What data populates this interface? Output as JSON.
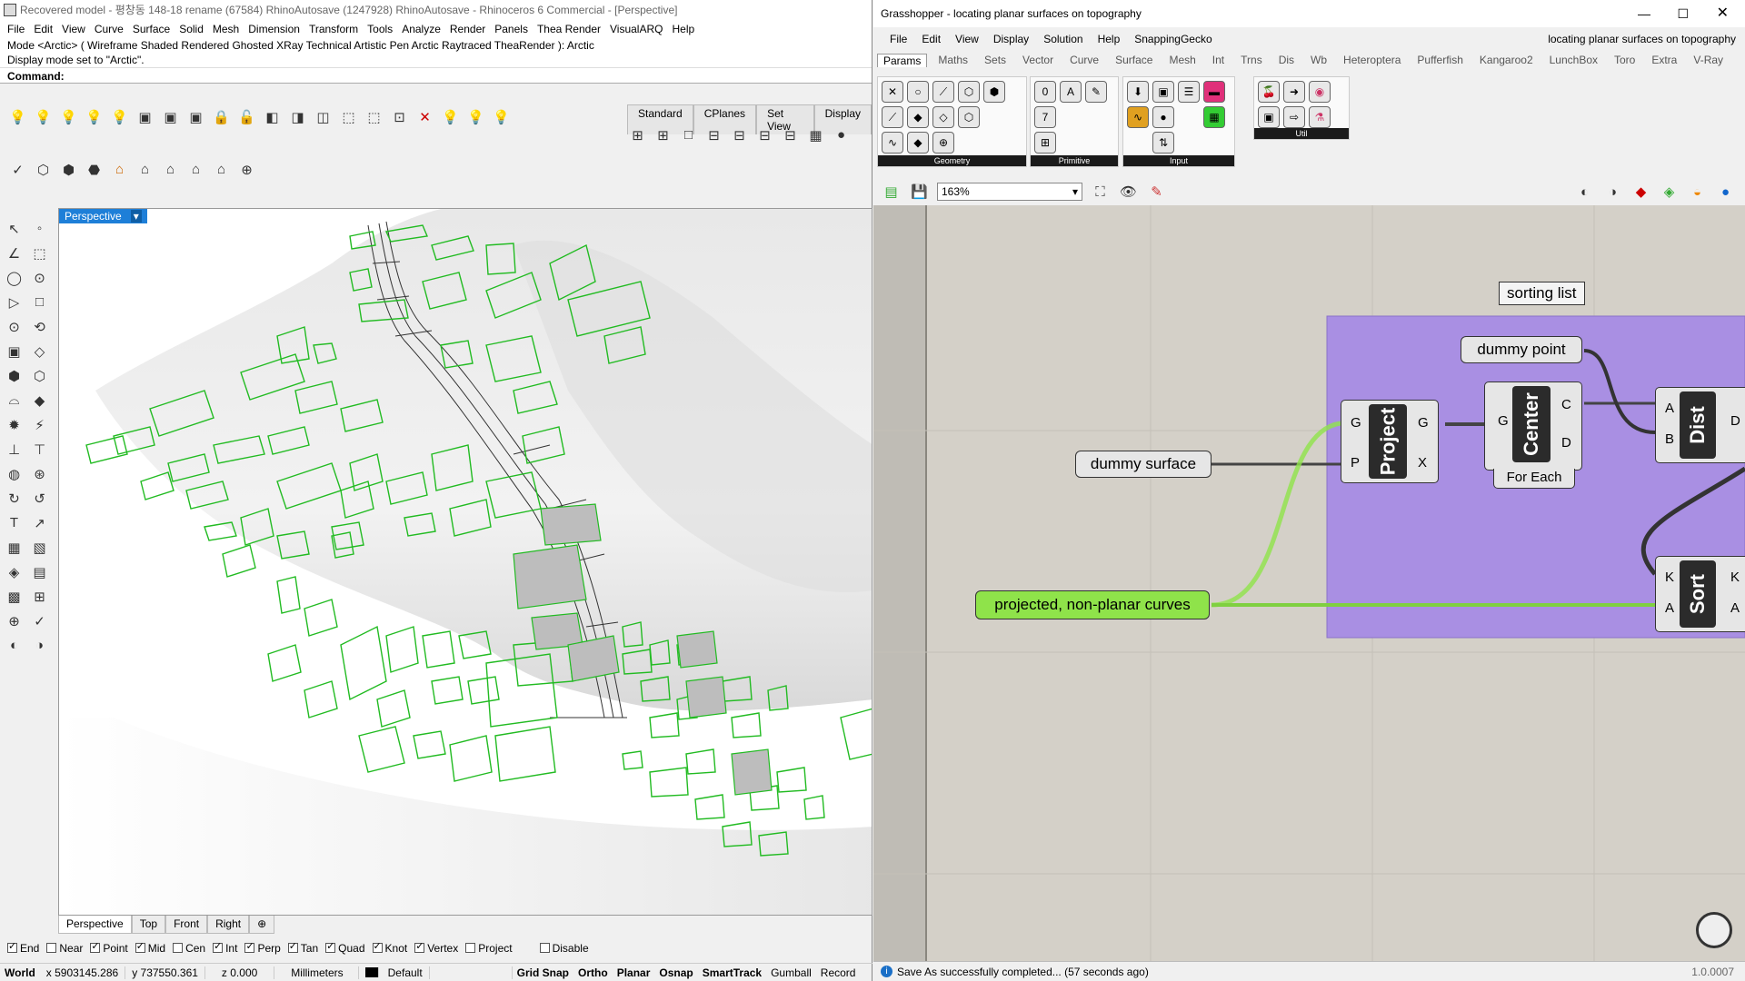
{
  "rhino": {
    "title": "Recovered model - 평창동 148-18 rename (67584) RhinoAutosave (1247928) RhinoAutosave - Rhinoceros 6 Commercial - [Perspective]",
    "menu": [
      "File",
      "Edit",
      "View",
      "Curve",
      "Surface",
      "Solid",
      "Mesh",
      "Dimension",
      "Transform",
      "Tools",
      "Analyze",
      "Render",
      "Panels",
      "Thea Render",
      "VisualARQ",
      "Help"
    ],
    "history_line1": "Mode <Arctic> ( Wireframe  Shaded  Rendered  Ghosted  XRay  Technical  Artistic  Pen  Arctic  Raytraced  TheaRender ): Arctic",
    "history_line2": "Display mode set to \"Arctic\".",
    "command_label": "Command:",
    "toolbar_tabs": [
      "Standard",
      "CPlanes",
      "Set View",
      "Display"
    ],
    "viewport_label": "Perspective",
    "viewport_tabs": [
      "Perspective",
      "Top",
      "Front",
      "Right"
    ],
    "osnap": [
      {
        "label": "End",
        "checked": true
      },
      {
        "label": "Near",
        "checked": false
      },
      {
        "label": "Point",
        "checked": true
      },
      {
        "label": "Mid",
        "checked": true
      },
      {
        "label": "Cen",
        "checked": false
      },
      {
        "label": "Int",
        "checked": true
      },
      {
        "label": "Perp",
        "checked": true
      },
      {
        "label": "Tan",
        "checked": true
      },
      {
        "label": "Quad",
        "checked": true
      },
      {
        "label": "Knot",
        "checked": true
      },
      {
        "label": "Vertex",
        "checked": true
      },
      {
        "label": "Project",
        "checked": false
      },
      {
        "label": "Disable",
        "checked": false
      }
    ],
    "status": {
      "cplane": "World",
      "x": "x 5903145.286",
      "y": "y 737550.361",
      "z": "z 0.000",
      "units": "Millimeters",
      "layer": "Default",
      "toggles": [
        "Grid Snap",
        "Ortho",
        "Planar",
        "Osnap",
        "SmartTrack",
        "Gumball",
        "Record"
      ]
    }
  },
  "grasshopper": {
    "title": "Grasshopper - locating planar surfaces on topography",
    "menu": [
      "File",
      "Edit",
      "View",
      "Display",
      "Solution",
      "Help",
      "SnappingGecko"
    ],
    "doc_name": "locating planar surfaces on topography",
    "tabs": [
      "Params",
      "Maths",
      "Sets",
      "Vector",
      "Curve",
      "Surface",
      "Mesh",
      "Int",
      "Trns",
      "Dis",
      "Wb",
      "Heteroptera",
      "Pufferfish",
      "Kangaroo2",
      "LunchBox",
      "Toro",
      "Extra",
      "V-Ray"
    ],
    "ribbon_groups": [
      "Geometry",
      "Primitive",
      "Input",
      "Util"
    ],
    "zoom": "163%",
    "group_label": "sorting list",
    "nodes": {
      "dummy_point": "dummy point",
      "dummy_surface": "dummy surface",
      "curves": "projected, non-planar curves"
    },
    "components": {
      "project": {
        "name": "Project",
        "inputs": [
          "G",
          "P"
        ],
        "outputs": [
          "G",
          "X"
        ]
      },
      "center": {
        "name": "Center",
        "inputs": [
          "G"
        ],
        "outputs": [
          "C",
          "D"
        ],
        "footer": "For Each"
      },
      "dist": {
        "name": "Dist",
        "inputs": [
          "A",
          "B"
        ],
        "outputs": [
          "D"
        ]
      },
      "sort": {
        "name": "Sort",
        "inputs": [
          "K",
          "A"
        ],
        "outputs": [
          "K",
          "A"
        ]
      }
    },
    "status_message": "Save As successfully completed... (57 seconds ago)",
    "version": "1.0.0007",
    "colors": {
      "group": "#a98fe3",
      "curves_node": "#8fe34a",
      "canvas": "#d4d0c8"
    }
  }
}
